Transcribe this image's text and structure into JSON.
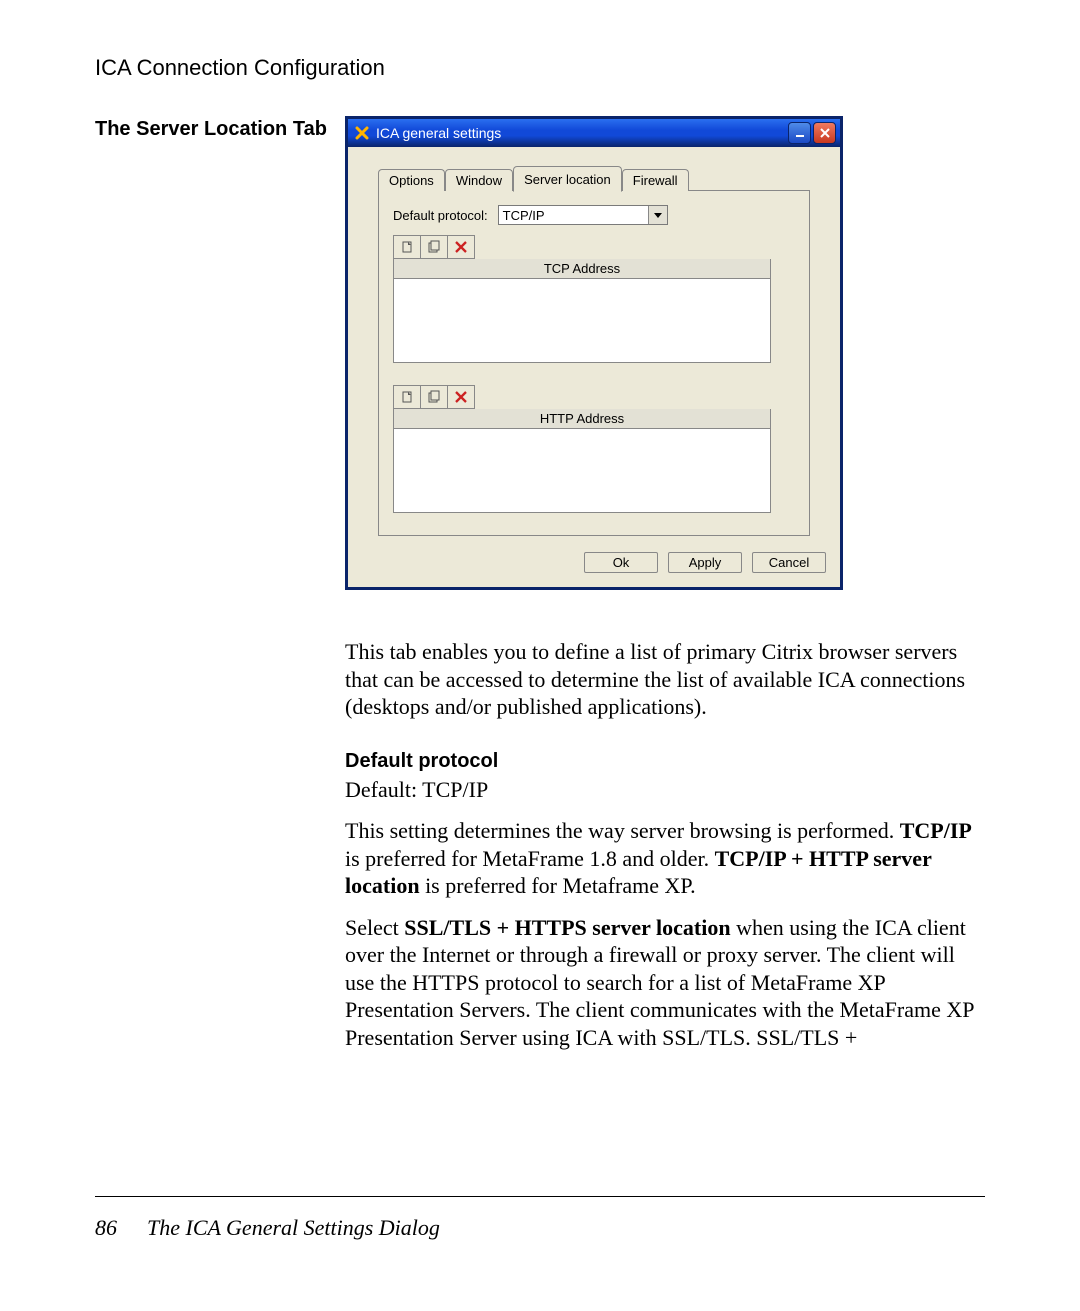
{
  "header": {
    "title": "ICA Connection Configuration"
  },
  "sidebar": {
    "heading": "The Server Location Tab"
  },
  "dialog": {
    "title": "ICA general settings",
    "tabs": [
      "Options",
      "Window",
      "Server location",
      "Firewall"
    ],
    "active_tab": "Server location",
    "protocol_label": "Default protocol:",
    "protocol_value": "TCP/IP",
    "list1_header": "TCP Address",
    "list2_header": "HTTP Address",
    "buttons": {
      "ok": "Ok",
      "apply": "Apply",
      "cancel": "Cancel"
    }
  },
  "copy": {
    "intro": "This tab enables you to define a list of primary Citrix browser servers that can be accessed to determine the list of available ICA connections (desktops and/or published applications).",
    "section_head": "Default protocol",
    "default_line": "Default: TCP/IP",
    "p2_a": "This setting determines the way server browsing is performed. ",
    "p2_b": "TCP/IP",
    "p2_c": " is preferred for MetaFrame 1.8 and older. ",
    "p2_d": "TCP/IP + HTTP server location",
    "p2_e": " is preferred for Metaframe XP.",
    "p3_a": "Select ",
    "p3_b": "SSL/TLS + HTTPS server location",
    "p3_c": " when using the ICA client over the Internet or through a firewall or proxy server. The client will use the HTTPS protocol to search for a list of MetaFrame XP Presentation Servers. The client communicates with the MetaFrame XP Presentation Server using ICA with SSL/TLS. SSL/TLS +"
  },
  "footer": {
    "page": "86",
    "title": "The ICA General Settings Dialog"
  }
}
